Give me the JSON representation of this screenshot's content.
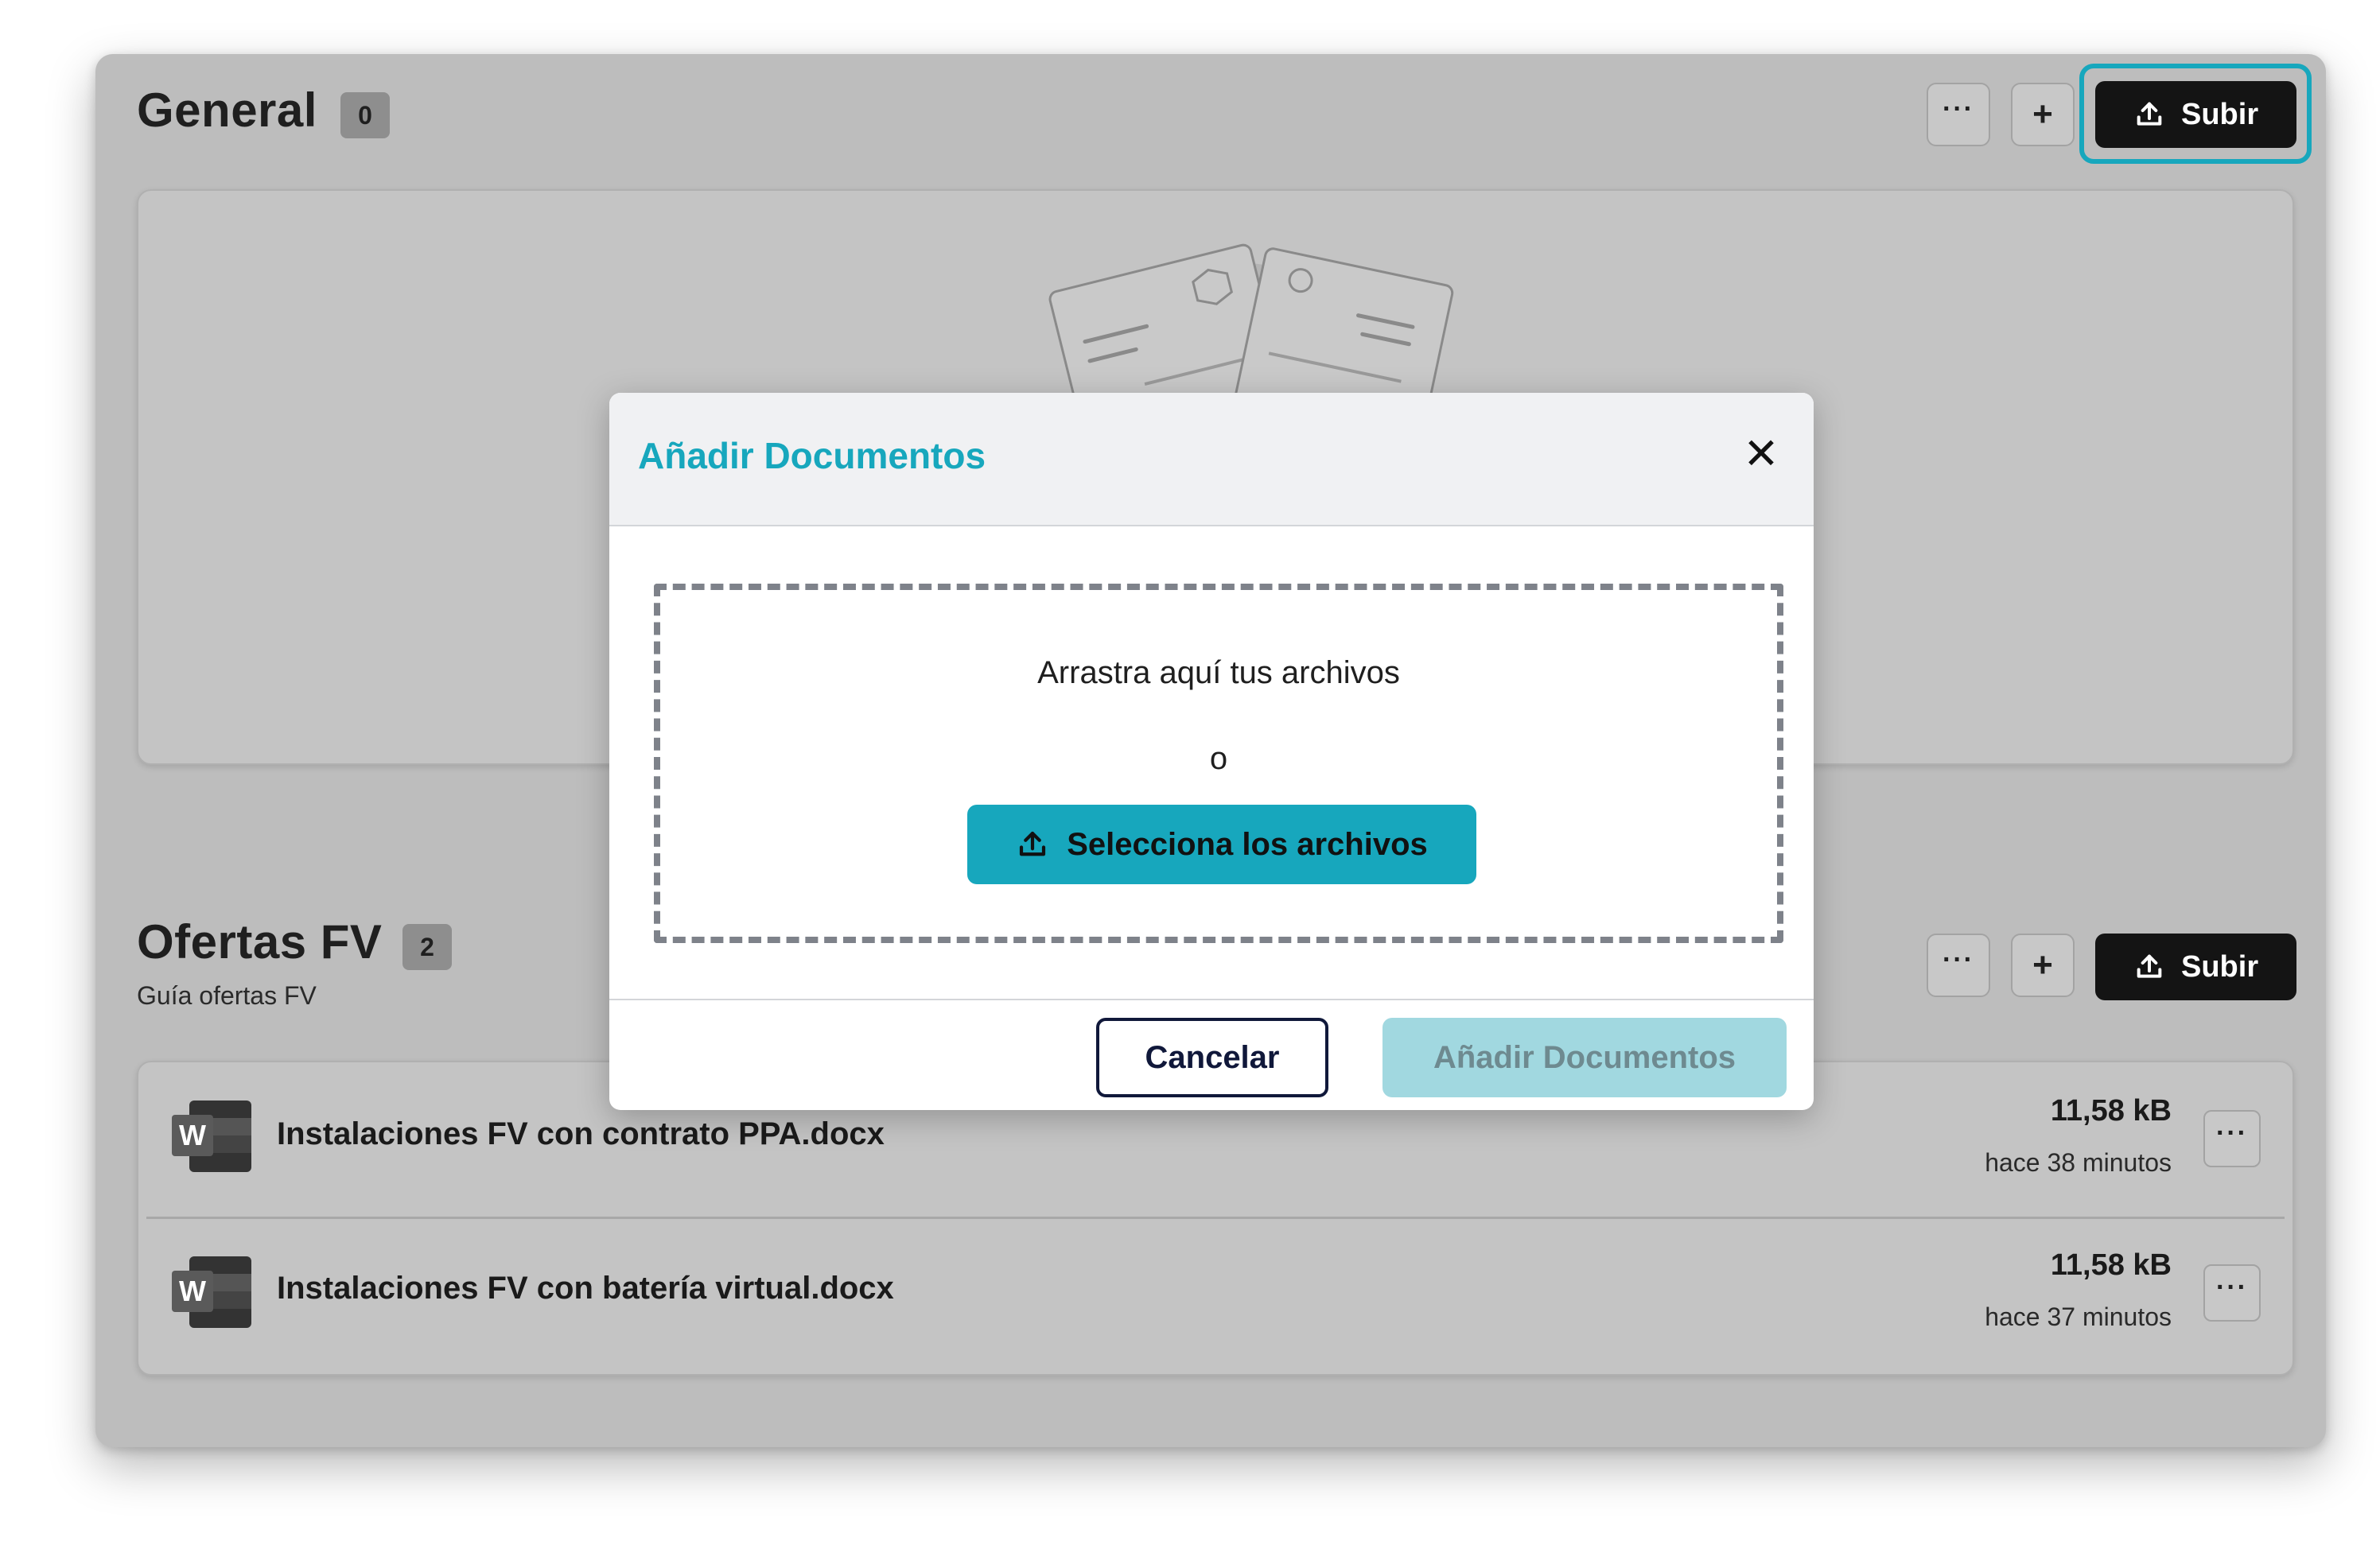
{
  "sections": {
    "general": {
      "title": "General",
      "count": "0",
      "upload_label": "Subir"
    },
    "ofertas": {
      "title": "Ofertas FV",
      "count": "2",
      "subtitle": "Guía ofertas FV",
      "upload_label": "Subir",
      "files": [
        {
          "name": "Instalaciones FV con contrato PPA.docx",
          "size": "11,58 kB",
          "time": "hace 38 minutos",
          "icon": "word-icon"
        },
        {
          "name": "Instalaciones FV con batería virtual.docx",
          "size": "11,58 kB",
          "time": "hace 37 minutos",
          "icon": "word-icon"
        }
      ]
    }
  },
  "icons": {
    "more": "···",
    "add": "+",
    "close": "✕",
    "upload": "upload-icon"
  },
  "modal": {
    "title": "Añadir Documentos",
    "drop_text": "Arrastra aquí tus archivos",
    "or_text": "o",
    "select_label": "Selecciona los archivos",
    "cancel_label": "Cancelar",
    "confirm_label": "Añadir Documentos"
  },
  "colors": {
    "accent": "#17a7bd",
    "accent_disabled": "#a1d8e0",
    "dark_button": "#141414",
    "overlay_panel": "#bdbdbd",
    "cancel_border": "#10183a"
  }
}
